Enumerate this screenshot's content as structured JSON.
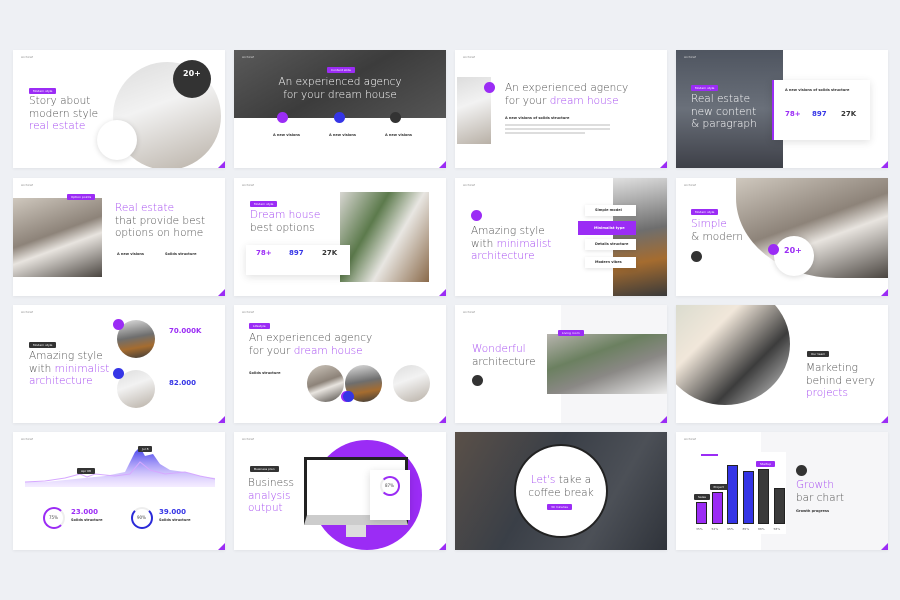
{
  "brand": "Archiraf",
  "colors": {
    "accent": "#9b2cf5",
    "blue": "#3535e6",
    "dark": "#333333",
    "background": "#eef0f4"
  },
  "slides": [
    {
      "tag": "Modern style",
      "title": [
        "Story about",
        "modern style"
      ],
      "highlight": "real estate",
      "badge_value": "20+"
    },
    {
      "tag": "Content slide",
      "title": [
        "An experienced agency",
        "for your dream house"
      ],
      "features": [
        "A new visions",
        "A new visions",
        "A new visions"
      ]
    },
    {
      "title": [
        "An experienced agency",
        "for your "
      ],
      "highlight": "dream house",
      "subtitle": "A new visions of solids structure"
    },
    {
      "tag": "Modern style",
      "title": [
        "Real estate",
        "new content",
        "& paragraph"
      ],
      "card_title": "A new visions of solids structure",
      "stats": [
        "78+",
        "897",
        "27K"
      ]
    },
    {
      "tag": "Option points",
      "highlight": "Real estate",
      "title": [
        "that provide best",
        "options on home"
      ],
      "features": [
        "A new visions",
        "Solids structure"
      ]
    },
    {
      "tag": "Modern style",
      "highlight": "Dream house",
      "title": [
        "best options"
      ],
      "stats": [
        "78+",
        "897",
        "27K"
      ]
    },
    {
      "title": [
        "Amazing style",
        "with "
      ],
      "highlight": "minimalist",
      "highlight2": "architecture",
      "options": [
        "Simple model",
        "Minimalist type",
        "Details structure",
        "Modern vibes"
      ]
    },
    {
      "tag": "Modern style",
      "highlight": "Simple",
      "title": [
        "& modern"
      ],
      "badge_value": "20+"
    },
    {
      "tag": "Modern style",
      "title": [
        "Amazing style",
        "with "
      ],
      "highlight": "minimalist",
      "highlight2": "architecture",
      "stats": [
        "70.000K",
        "82.000"
      ]
    },
    {
      "tag": "Lifestyle",
      "title": [
        "An experienced agency",
        "for your "
      ],
      "highlight": "dream house",
      "subtitle": "Solids structure"
    },
    {
      "tag": "Living room",
      "highlight": "Wonderful",
      "title": [
        "architecture"
      ]
    },
    {
      "tag": "Our team",
      "title": [
        "Marketing",
        "behind every"
      ],
      "highlight": "projects"
    },
    {
      "tooltips": [
        "Apr 08",
        "Jul 8"
      ],
      "rings": [
        {
          "pct": "75%",
          "value": "23.000",
          "label": "Solids structure"
        },
        {
          "pct": "90%",
          "value": "39.000",
          "label": "Solids structure"
        }
      ]
    },
    {
      "tag": "Business plan",
      "title": [
        "Business"
      ],
      "highlight": "analysis",
      "highlight2": "output",
      "ring": "87%"
    },
    {
      "highlight": "Let's",
      "title": [
        " take a",
        "coffee break"
      ],
      "button": "30 minutes"
    },
    {
      "highlight": "Growth",
      "title": [
        "bar chart"
      ],
      "subtitle": "Growth progress"
    }
  ],
  "chart_data": {
    "type": "bar",
    "categories": [
      "35%",
      "52%",
      "95%",
      "85%",
      "88%",
      "58%"
    ],
    "values": [
      35,
      52,
      95,
      85,
      88,
      58
    ],
    "annotations": [
      "Sales",
      "Project",
      "Startup"
    ],
    "ylim": [
      0,
      100
    ]
  }
}
